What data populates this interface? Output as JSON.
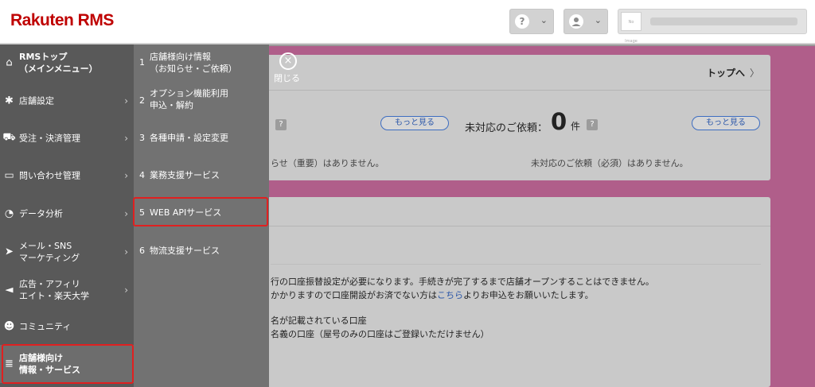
{
  "header": {
    "logo": "Rakuten RMS",
    "help_glyph": "?",
    "caret": "⌄",
    "store_noimage": "No Image"
  },
  "main_nav": {
    "items": [
      {
        "icon": "home-icon",
        "glyph": "⌂",
        "label": "RMSトップ\n（メインメニュー）",
        "has_arrow": false
      },
      {
        "icon": "gear-icon",
        "glyph": "✱",
        "label": "店舗設定",
        "has_arrow": true
      },
      {
        "icon": "cart-icon",
        "glyph": "⛟",
        "label": "受注・決済管理",
        "has_arrow": true
      },
      {
        "icon": "inquiry-icon",
        "glyph": "▭",
        "label": "問い合わせ管理",
        "has_arrow": true
      },
      {
        "icon": "analytics-icon",
        "glyph": "◔",
        "label": "データ分析",
        "has_arrow": true
      },
      {
        "icon": "paper-plane-icon",
        "glyph": "➤",
        "label": "メール・SNS\nマーケティング",
        "has_arrow": true
      },
      {
        "icon": "megaphone-icon",
        "glyph": "◄",
        "label": "広告・アフィリ\nエイト・楽天大学",
        "has_arrow": true
      },
      {
        "icon": "community-icon",
        "glyph": "☻",
        "label": "コミュニティ",
        "has_arrow": false
      },
      {
        "icon": "list-icon",
        "glyph": "≣",
        "label": "店舗様向け\n情報・サービス",
        "has_arrow": false
      }
    ],
    "arrow": "›"
  },
  "sub_nav": {
    "items": [
      {
        "num": "1",
        "label": "店舗様向け情報\n（お知らせ・ご依頼）"
      },
      {
        "num": "2",
        "label": "オプション機能利用\n申込・解約"
      },
      {
        "num": "3",
        "label": "各種申請・設定変更"
      },
      {
        "num": "4",
        "label": "業務支援サービス"
      },
      {
        "num": "5",
        "label": "WEB APIサービス"
      },
      {
        "num": "6",
        "label": "物流支援サービス"
      }
    ]
  },
  "content": {
    "close_label": "閉じる",
    "close_glyph": "×",
    "top_link": "トップへ",
    "top_chevron": "〉",
    "more_label": "もっと見る",
    "request_label": "未対応のご依頼：",
    "request_count": "0",
    "request_unit": "件",
    "notice_empty": "らせ（重要）はありません。",
    "request_empty": "未対応のご依頼（必須）はありません。",
    "bulb_glyph": "?",
    "body_line1": "行の口座振替設定が必要になります。手続きが完了するまで店舗オープンすることはできません。",
    "body_line2_a": "かかりますので口座開設がお済でない方は",
    "body_line2_link": "こちら",
    "body_line2_b": "よりお申込をお願いいたします。",
    "body_line3": "名が記載されている口座",
    "body_line4": "名義の口座（屋号のみの口座はご登録いただけません）"
  },
  "colors": {
    "brand": "#bf0000",
    "highlight": "#e02020",
    "pink_bg": "#b05e8a",
    "link": "#2a56a8"
  }
}
